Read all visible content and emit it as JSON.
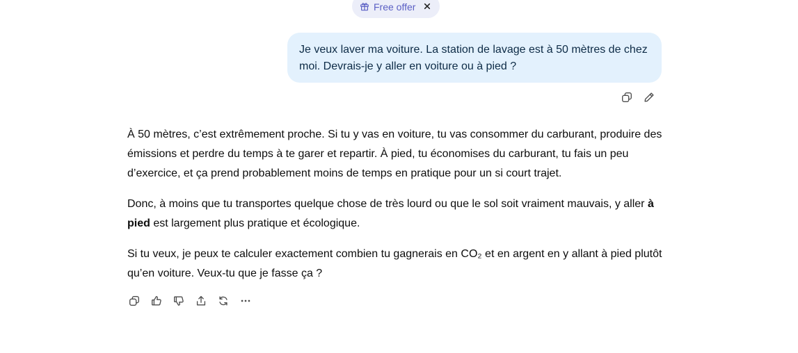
{
  "offer": {
    "label": "Free offer",
    "icon": "gift-icon",
    "accent": "#5a5fc4",
    "background": "#eceef9"
  },
  "user_message": {
    "text": "Je veux laver ma voiture. La station de lavage est à 50 mètres de chez moi. Devrais-je y aller en voiture ou à pied ?",
    "bubble_color": "#e3f1fd"
  },
  "user_actions": [
    "copy-icon",
    "edit-icon"
  ],
  "assistant": {
    "paragraph1": "À 50 mètres, c’est extrêmement proche. Si tu y vas en voiture, tu vas consommer du carburant, produire des émissions et perdre du temps à te garer et repartir. À pied, tu économises du carburant, tu fais un peu d’exercice, et ça prend probablement moins de temps en pratique pour un si court trajet.",
    "paragraph2_start": "Donc, à moins que tu transportes quelque chose de très lourd ou que le sol soit vraiment mauvais, y aller ",
    "paragraph2_bold": "à pied",
    "paragraph2_end": " est largement plus pratique et écologique.",
    "paragraph3": "Si tu veux, je peux te calculer exactement combien tu gagnerais en CO₂ et en argent en y allant à pied plutôt qu’en voiture. Veux-tu que je fasse ça ?"
  },
  "assistant_actions": [
    "copy-icon",
    "thumbs-up-icon",
    "thumbs-down-icon",
    "share-icon",
    "regenerate-icon",
    "more-icon"
  ]
}
